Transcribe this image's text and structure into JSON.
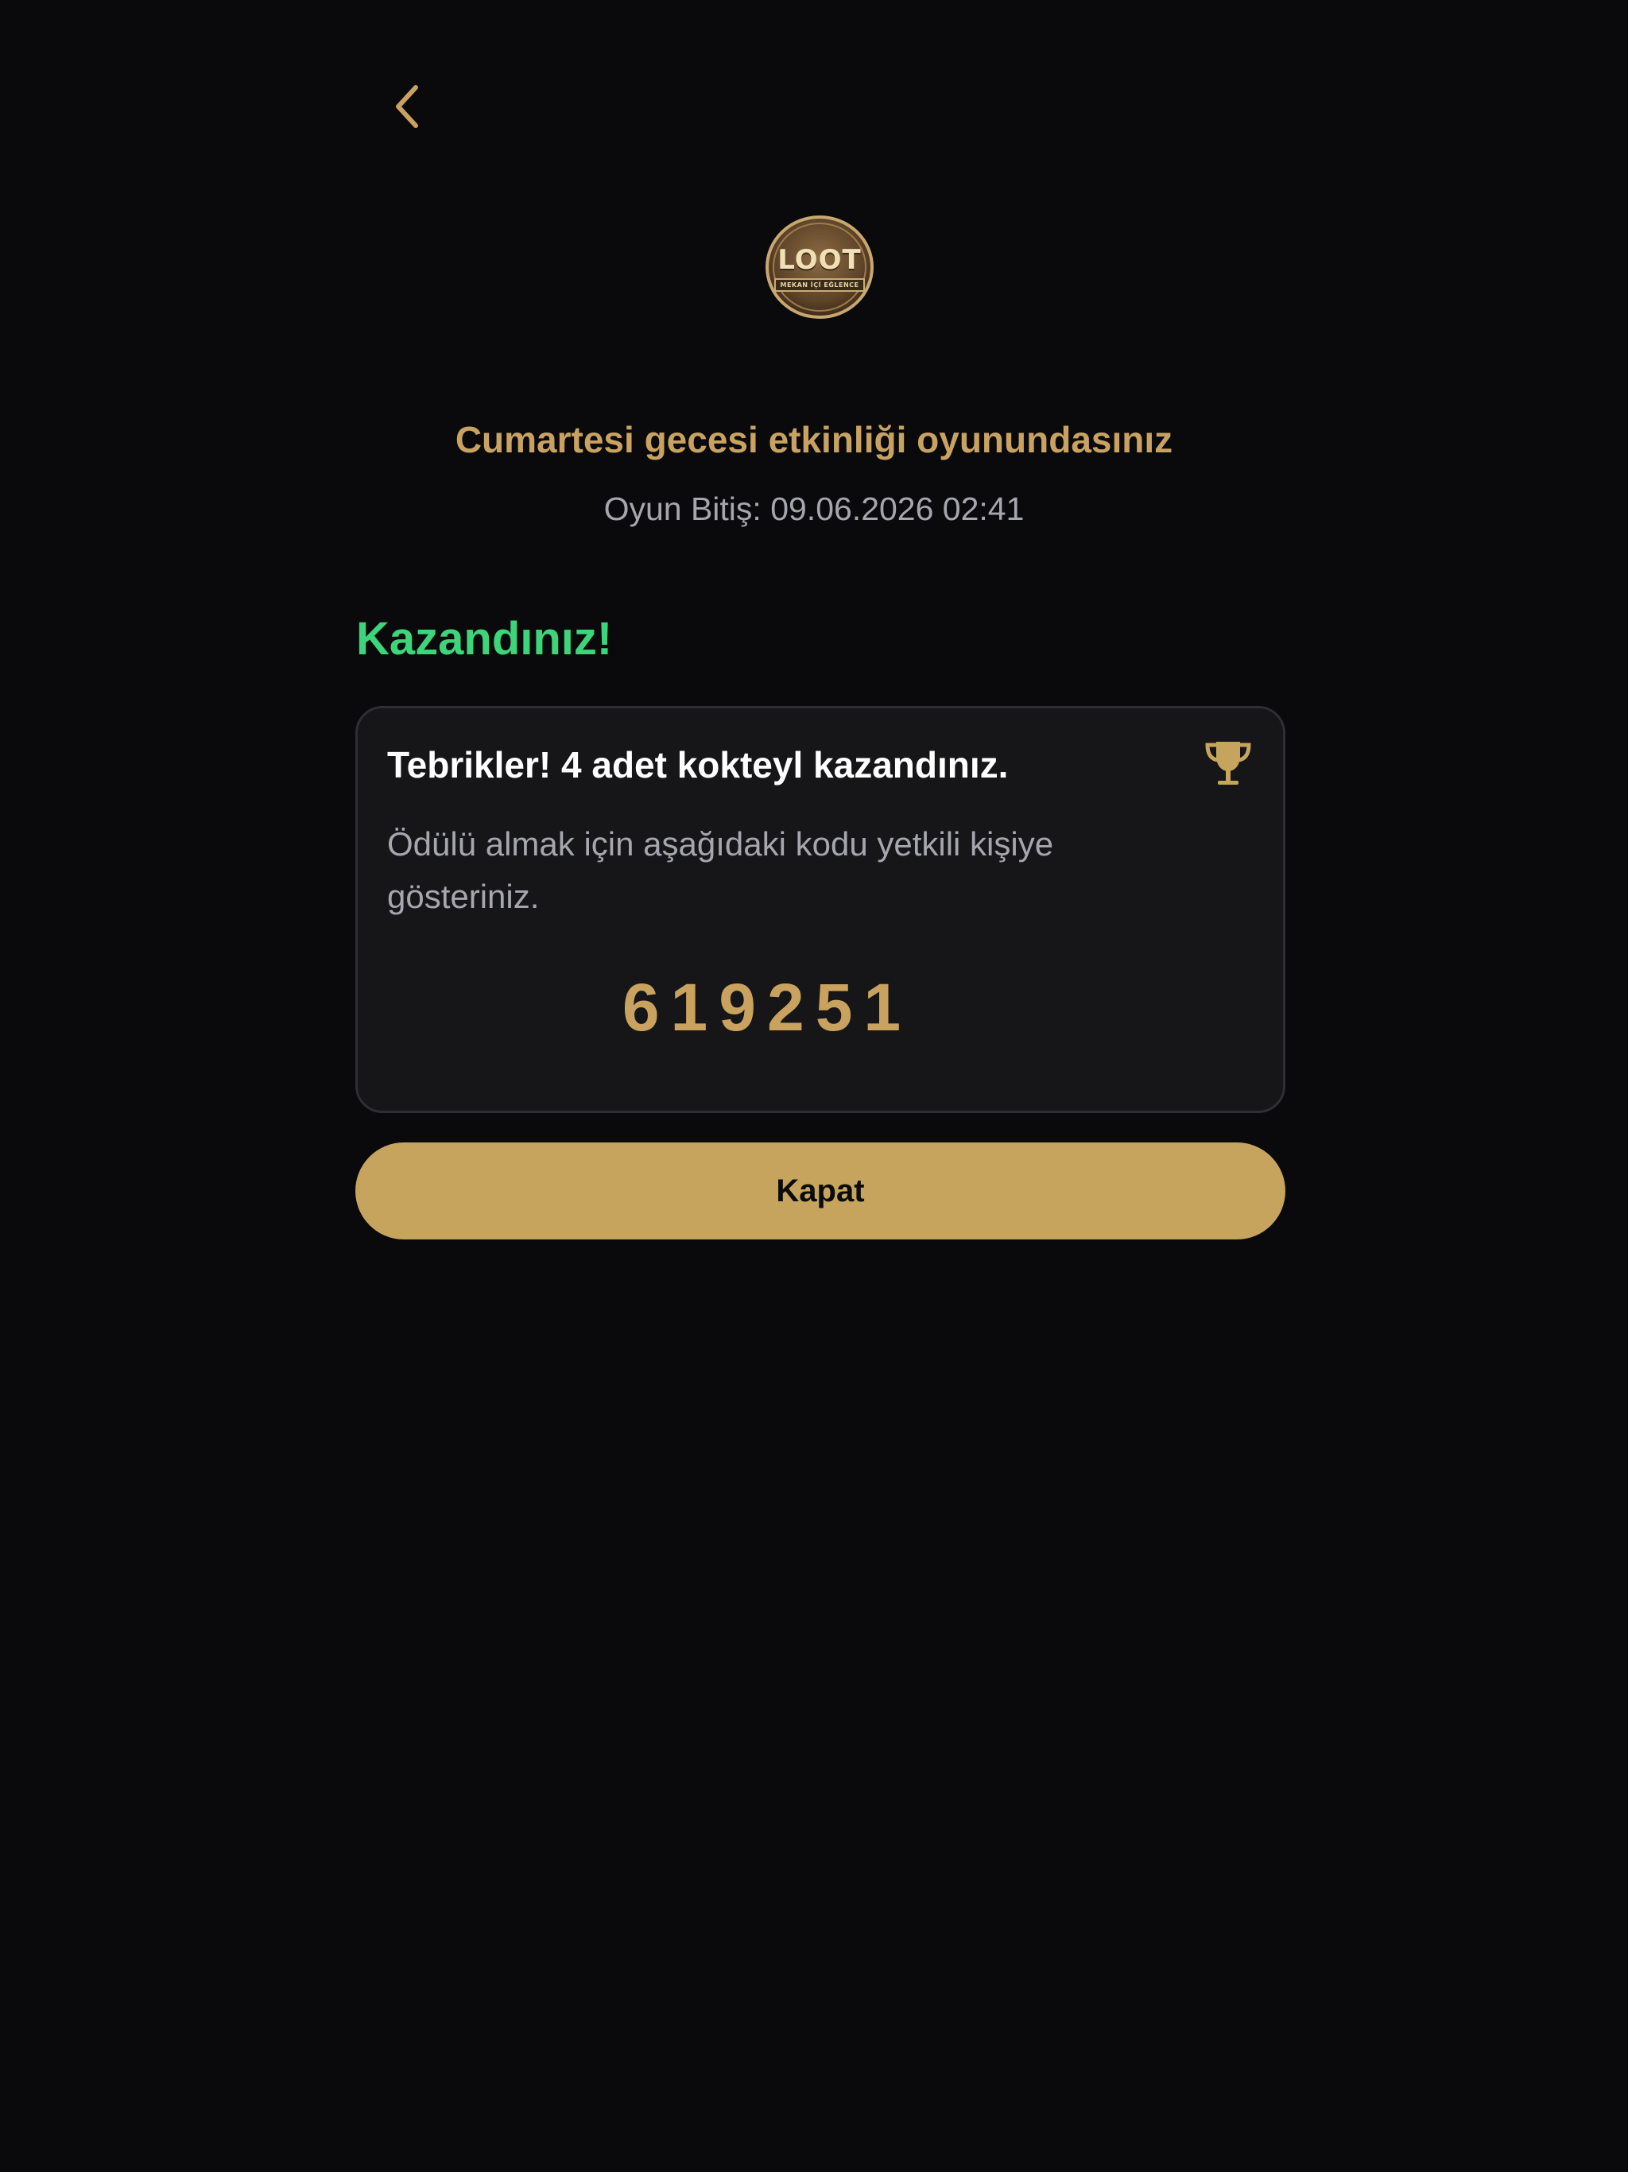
{
  "header": {
    "back_icon": "chevron-left-icon"
  },
  "logo": {
    "word": "LOOT",
    "subtitle": "MEKAN İÇİ EĞLENCE"
  },
  "game": {
    "title": "Cumartesi gecesi etkinliği oyunundasınız",
    "end_text": "Oyun Bitiş: 09.06.2026 02:41"
  },
  "result": {
    "heading": "Kazandınız!"
  },
  "prize_card": {
    "title": "Tebrikler! 4 adet kokteyl kazandınız.",
    "description": "Ödülü almak için aşağıdaki kodu yetkili kişiye gösteriniz.",
    "code": "619251",
    "icon": "trophy-icon"
  },
  "actions": {
    "close_label": "Kapat"
  },
  "colors": {
    "background": "#0a0a0c",
    "accent_gold": "#c6a45e",
    "title_gold": "#c9a262",
    "success_green": "#3ed47a",
    "muted_text": "#a6a6ae",
    "card_background": "#161618",
    "card_border": "#2e2e33"
  }
}
